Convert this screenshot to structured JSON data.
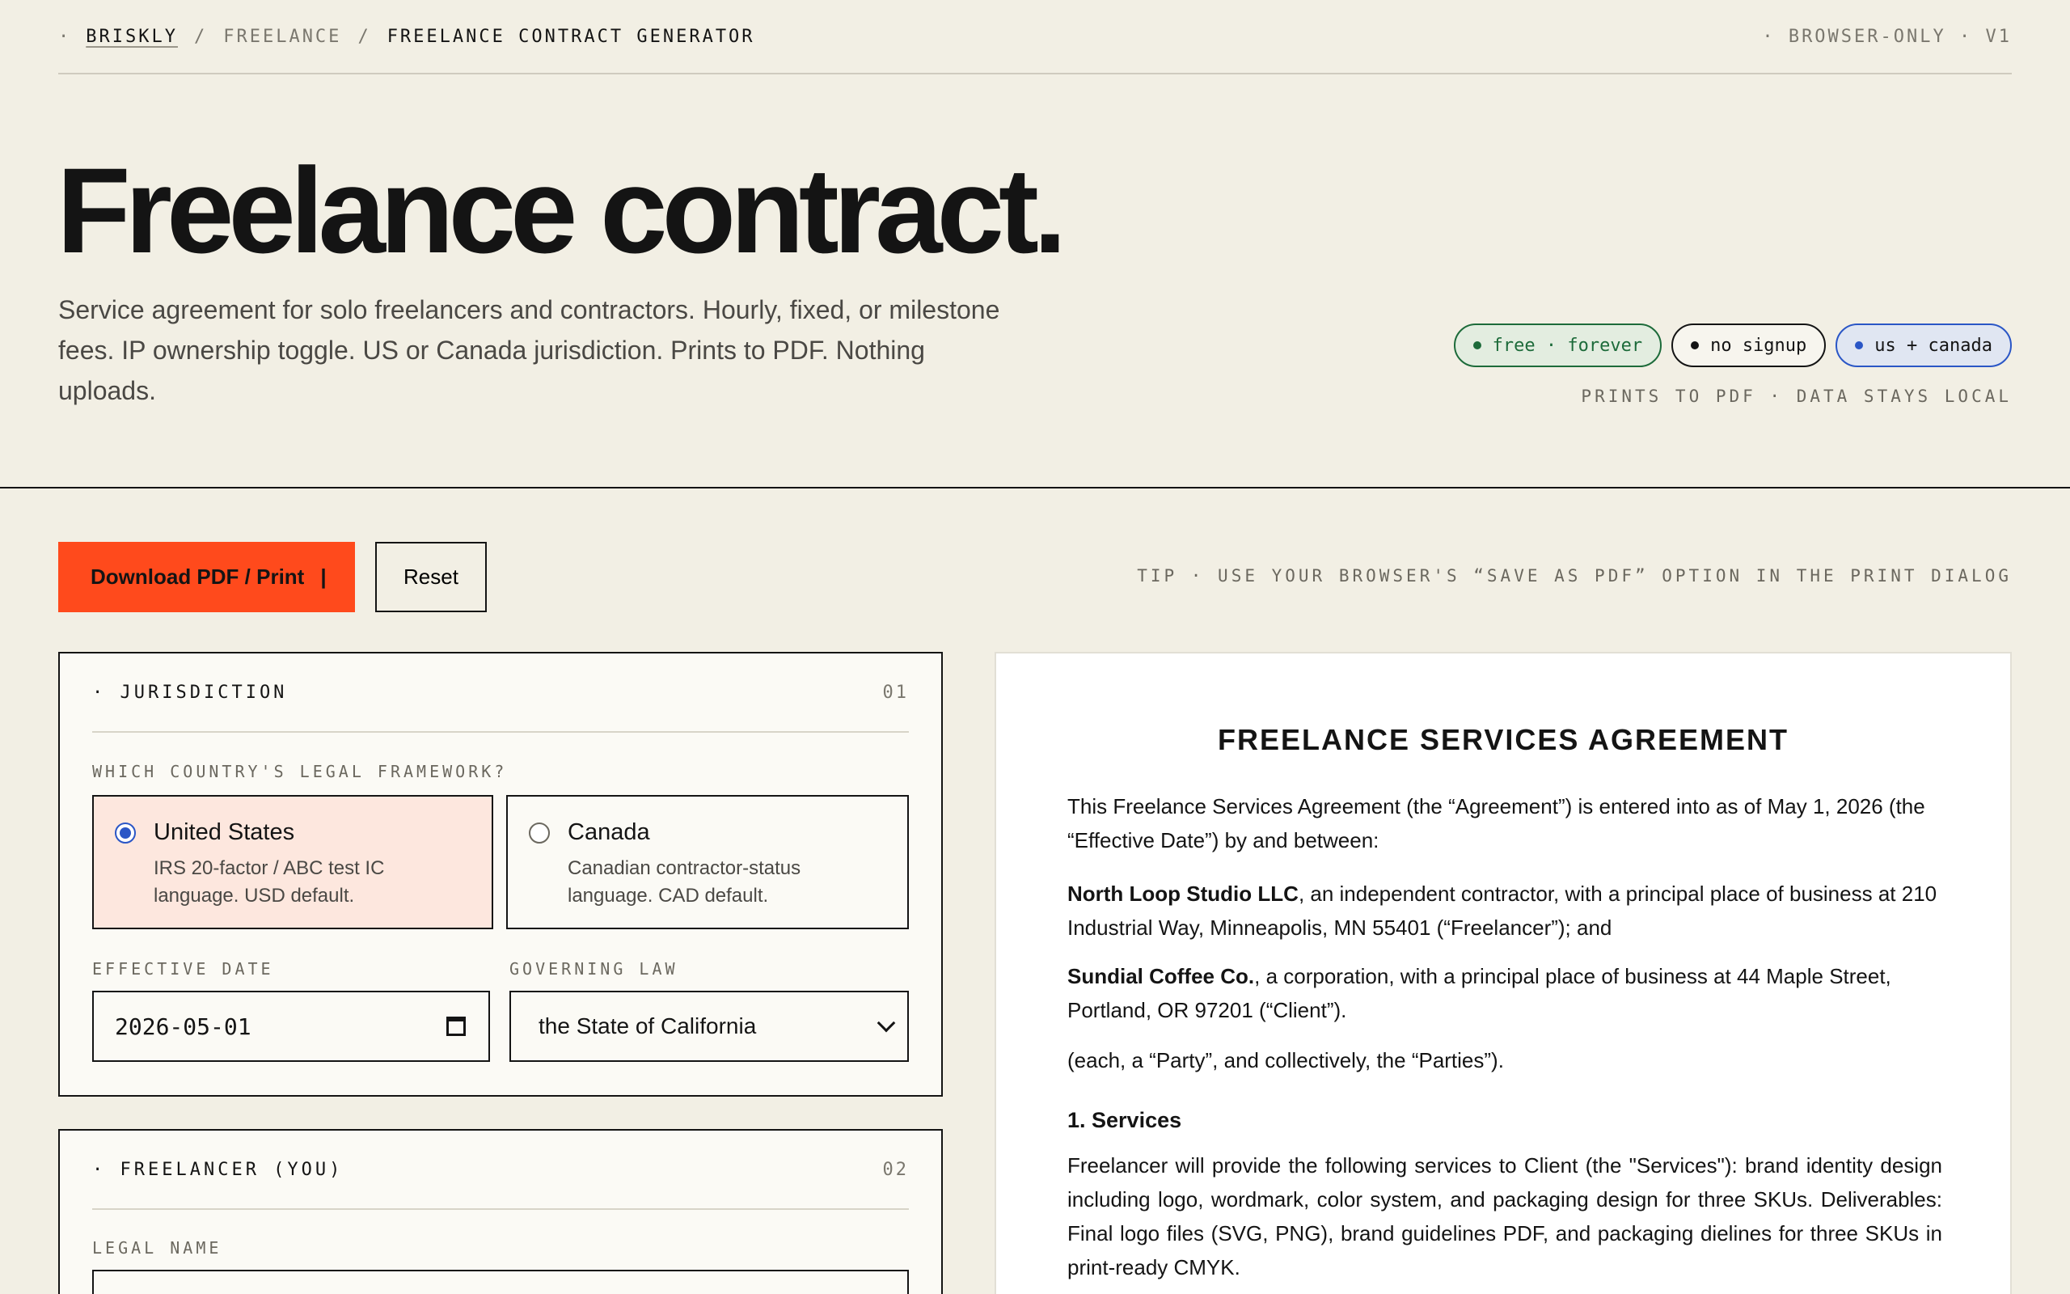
{
  "nav": {
    "dot": "·",
    "home": "BRISKLY",
    "sep": "/",
    "section": "FREELANCE",
    "current": "FREELANCE CONTRACT GENERATOR",
    "right": "· BROWSER-ONLY · V1"
  },
  "hero": {
    "title": "Freelance contract.",
    "subtitle": "Service agreement for solo freelancers and contractors. Hourly, fixed, or milestone fees. IP ownership toggle. US or Canada jurisdiction. Prints to PDF. Nothing uploads.",
    "chips": [
      {
        "label": "free · forever",
        "color": "#1d6b3a"
      },
      {
        "label": "no signup",
        "color": "#141414"
      },
      {
        "label": "us + canada",
        "color": "#2a56c6"
      }
    ],
    "note": "PRINTS TO PDF · DATA STAYS LOCAL"
  },
  "actions": {
    "download_label": "Download PDF / Print",
    "download_caret": "|",
    "reset_label": "Reset",
    "tip": "TIP · USE YOUR BROWSER'S “SAVE AS PDF” OPTION IN THE PRINT DIALOG"
  },
  "jurisdiction": {
    "title": "· JURISDICTION",
    "number": "01",
    "question": "WHICH COUNTRY'S LEGAL FRAMEWORK?",
    "options": [
      {
        "title": "United States",
        "desc": "IRS 20-factor / ABC test IC language. USD default.",
        "selected": true
      },
      {
        "title": "Canada",
        "desc": "Canadian contractor-status language. CAD default.",
        "selected": false
      }
    ],
    "effective_date_label": "EFFECTIVE DATE",
    "effective_date_value": "2026-05-01",
    "governing_law_label": "GOVERNING LAW",
    "governing_law_value": "the State of California"
  },
  "freelancer": {
    "title": "· FREELANCER (YOU)",
    "number": "02",
    "legal_name_label": "LEGAL NAME"
  },
  "document": {
    "title": "FREELANCE SERVICES AGREEMENT",
    "intro": "This Freelance Services Agreement (the “Agreement”) is entered into as of May 1, 2026 (the “Effective Date”) by and between:",
    "freelancer_name": "North Loop Studio LLC",
    "freelancer_rest": ", an independent contractor, with a principal place of business at 210 Industrial Way, Minneapolis, MN 55401 (“Freelancer”); and",
    "client_name": "Sundial Coffee Co.",
    "client_rest": ", a corporation, with a principal place of business at 44 Maple Street, Portland, OR 97201 (“Client”).",
    "parties": "(each, a “Party”, and collectively, the “Parties”).",
    "section1_heading": "1. Services",
    "section1_body": "Freelancer will provide the following services to Client (the \"Services\"): brand identity design including logo, wordmark, color system, and packaging design for three SKUs. Deliverables: Final logo files (SVG, PNG), brand guidelines PDF, and packaging dielines for three SKUs in print-ready CMYK."
  }
}
